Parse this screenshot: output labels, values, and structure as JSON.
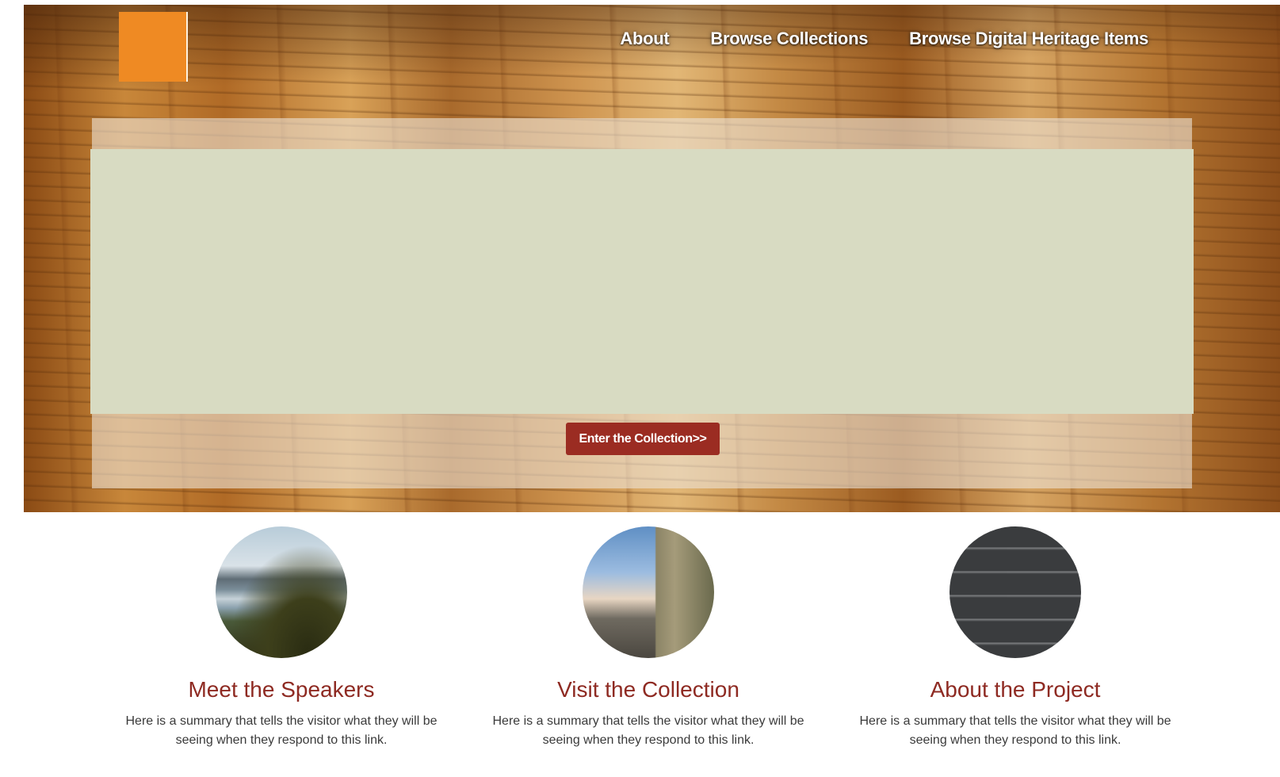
{
  "nav": {
    "items": [
      {
        "label": "About"
      },
      {
        "label": "Browse Collections"
      },
      {
        "label": "Browse Digital Heritage Items"
      }
    ]
  },
  "hero": {
    "cta_label": "Enter the Collection>>"
  },
  "cards": [
    {
      "title": "Meet the Speakers",
      "summary": "Here is a summary that tells the visitor what they will be seeing when they respond to this link.",
      "image": "lake-mountains"
    },
    {
      "title": "Visit the Collection",
      "summary": "Here is a summary that tells the visitor what they will be seeing when they respond to this link.",
      "image": "street-building"
    },
    {
      "title": "About the Project",
      "summary": "Here is a summary that tells the visitor what they will be seeing when they respond to this link.",
      "image": "archive-boxes"
    }
  ],
  "colors": {
    "logo": "#ef8a23",
    "accent": "#9b2c22",
    "card_title": "#8e2a22",
    "feature_panel": "#d8dbc2"
  }
}
